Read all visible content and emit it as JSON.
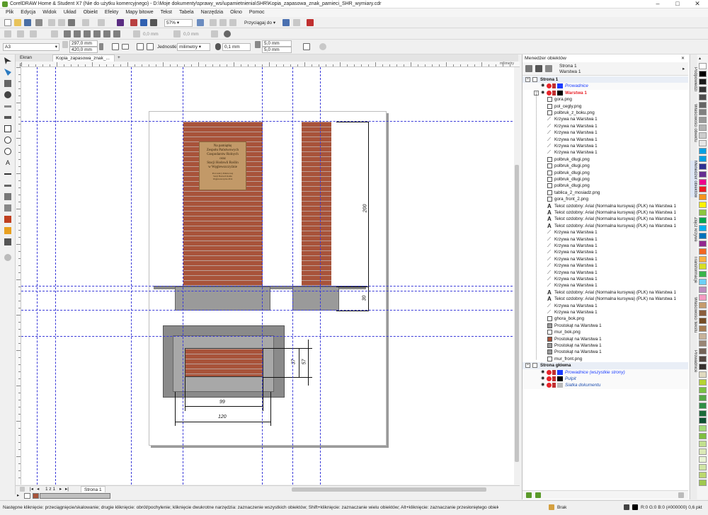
{
  "window": {
    "title": "CorelDRAW Home & Student X7 (Nie do użytku komercyjnego) - D:\\Moje dokumenty\\sprawy_wsi\\upamietnienia\\SHR\\Kopia_zapasowa_znak_pamieci_SHR_wymiary.cdr"
  },
  "menu": [
    "Plik",
    "Edycja",
    "Widok",
    "Układ",
    "Obiekt",
    "Efekty",
    "Mapy bitowe",
    "Tekst",
    "Tabela",
    "Narzędzia",
    "Okno",
    "Pomoc"
  ],
  "standard_toolbar": {
    "zoom": "57%",
    "snap": "Przyciągaj do"
  },
  "property_bar": {
    "paper": "A3",
    "width": "297,0 mm",
    "height": "420,0 mm",
    "units_label": "Jednostki:",
    "units": "milimetry",
    "nudge": "0,1 mm",
    "dup_x": "5,0 mm",
    "dup_y": "5,0 mm",
    "disabled_x": "0,0 mm",
    "disabled_y": "0,0 mm"
  },
  "tabs": [
    "Ekran powitalny",
    "Kopia_zapasowa_znak_..."
  ],
  "ruler": {
    "unit": "milimetry"
  },
  "drawing": {
    "plaque_lines": [
      "Na pamiątkę",
      "Zespołu Państwowych",
      "Gospodarstw Rolnych",
      "oraz",
      "Stacji Hodowli Roślin",
      "w Węglewszczyźnie"
    ],
    "plaque_small": [
      "Pracownicy Państwowej",
      "Stacji Hodowli Roślin",
      "Węglewszczyzna 2014"
    ],
    "dimensions": {
      "height_main": "200",
      "height_base": "30",
      "inner_height": "37",
      "outer_height": "57",
      "inner_width": "99",
      "outer_width": "120"
    }
  },
  "page_nav": {
    "counter": "1 z 1",
    "page_tab": "Strona 1"
  },
  "status": {
    "hint": "Następne kliknięcie: przeciągnięcie/skalowanie; drugie kliknięcie: obrót/pochylenie; kliknięcie dwukrotne narzędzia: zaznaczenie wszystkich obiektów; Shift+kliknięcie: zaznaczanie wielu obiektów; Alt+kliknięcie: zaznaczanie przesłoniętego obiektu;",
    "fill": "Brak",
    "outline": "R:0 G:0 B:0 (#000000)  0,6 pkt"
  },
  "object_manager": {
    "title": "Menedżer obiektów",
    "header_page": "Strona 1",
    "header_layer": "Warstwa 1",
    "page1": "Strona 1",
    "guides": "Prowadnice",
    "layer1": "Warstwa 1",
    "items": [
      {
        "icon": "bitmap",
        "label": "gora.png"
      },
      {
        "icon": "bitmap",
        "label": "pol_cegly.png"
      },
      {
        "icon": "bitmap",
        "label": "polbruk_z_boku.png"
      },
      {
        "icon": "curve",
        "label": "Krzywa na Warstwa 1"
      },
      {
        "icon": "curve",
        "label": "Krzywa na Warstwa 1"
      },
      {
        "icon": "curve",
        "label": "Krzywa na Warstwa 1"
      },
      {
        "icon": "curve",
        "label": "Krzywa na Warstwa 1"
      },
      {
        "icon": "curve",
        "label": "Krzywa na Warstwa 1"
      },
      {
        "icon": "curve",
        "label": "Krzywa na Warstwa 1"
      },
      {
        "icon": "bitmap",
        "label": "polbruk_dlugi.png"
      },
      {
        "icon": "bitmap",
        "label": "polbruk_dlugi.png"
      },
      {
        "icon": "bitmap",
        "label": "polbruk_dlugi.png"
      },
      {
        "icon": "bitmap",
        "label": "polbruk_dlugi.png"
      },
      {
        "icon": "bitmap",
        "label": "polbruk_dlugi.png"
      },
      {
        "icon": "bitmap",
        "label": "tablica_2_mosiadz.png"
      },
      {
        "icon": "bitmap",
        "label": "gora_front_2.png"
      },
      {
        "icon": "text",
        "label": "Tekst ozdobny: Arial (Normalna kursywa) (PLK) na Warstwa 1"
      },
      {
        "icon": "text",
        "label": "Tekst ozdobny: Arial (Normalna kursywa) (PLK) na Warstwa 1"
      },
      {
        "icon": "text",
        "label": "Tekst ozdobny: Arial (Normalna kursywa) (PLK) na Warstwa 1"
      },
      {
        "icon": "text",
        "label": "Tekst ozdobny: Arial (Normalna kursywa) (PLK) na Warstwa 1"
      },
      {
        "icon": "curve",
        "label": "Krzywa na Warstwa 1"
      },
      {
        "icon": "curve",
        "label": "Krzywa na Warstwa 1"
      },
      {
        "icon": "curve",
        "label": "Krzywa na Warstwa 1"
      },
      {
        "icon": "curve",
        "label": "Krzywa na Warstwa 1"
      },
      {
        "icon": "curve",
        "label": "Krzywa na Warstwa 1"
      },
      {
        "icon": "curve",
        "label": "Krzywa na Warstwa 1"
      },
      {
        "icon": "curve",
        "label": "Krzywa na Warstwa 1"
      },
      {
        "icon": "curve",
        "label": "Krzywa na Warstwa 1"
      },
      {
        "icon": "curve",
        "label": "Krzywa na Warstwa 1"
      },
      {
        "icon": "text",
        "label": "Tekst ozdobny: Arial (Normalna kursywa) (PLK) na Warstwa 1"
      },
      {
        "icon": "text",
        "label": "Tekst ozdobny: Arial (Normalna kursywa) (PLK) na Warstwa 1"
      },
      {
        "icon": "curve",
        "label": "Krzywa na Warstwa 1"
      },
      {
        "icon": "curve",
        "label": "Krzywa na Warstwa 1"
      },
      {
        "icon": "bitmap",
        "label": "ghora_bok.png"
      },
      {
        "icon": "rect-gray",
        "label": "Prostokąt na Warstwa 1"
      },
      {
        "icon": "bitmap",
        "label": "mur_bok.png"
      },
      {
        "icon": "rect-brick",
        "label": "Prostokąt na Warstwa 1"
      },
      {
        "icon": "rect-gray",
        "label": "Prostokąt na Warstwa 1"
      },
      {
        "icon": "rect-gray",
        "label": "Prostokąt na Warstwa 1"
      },
      {
        "icon": "bitmap",
        "label": "mur_front.png"
      }
    ],
    "master_page": "Strona główna",
    "master_items": [
      {
        "label": "Prowadnice (wszystkie strony)",
        "color": "#1a3cff"
      },
      {
        "label": "Pulpit",
        "color": "#000000"
      },
      {
        "label": "Siatka dokumentu",
        "color": "#bbbbbb"
      }
    ]
  },
  "docker_tabs": [
    "Podpowiedzi",
    "Właściwości obiektu",
    "Menedżer obiektów",
    "Złącz krzywe",
    "Transformacje",
    "Właściwości tekstu",
    "Prowadnice"
  ],
  "colors": {
    "brick": "#a8533a",
    "plaque": "#c29968",
    "base": "#9a9a9a",
    "guide": "#3a3ad8",
    "selected": "#e8242a",
    "palette": [
      "#ffffff",
      "#000000",
      "#1a1a1a",
      "#333333",
      "#4d4d4d",
      "#666666",
      "#808080",
      "#999999",
      "#b3b3b3",
      "#cccccc",
      "#e6e6e6",
      "#00a0e3",
      "#009fe3",
      "#2e3192",
      "#662d91",
      "#ec008c",
      "#ed1c24",
      "#f7941d",
      "#fff200",
      "#8dc63f",
      "#00a651",
      "#00aeef",
      "#0072bc",
      "#92278f",
      "#f26522",
      "#fbb040",
      "#d7df23",
      "#39b54a",
      "#6dcff6",
      "#bd8cbf",
      "#f49ac1",
      "#c69c6d",
      "#8b5e3c",
      "#754c24",
      "#a67c52",
      "#c7b299",
      "#998675",
      "#736357",
      "#534741",
      "#362f2d",
      "#e0d9c0",
      "#b5d334",
      "#7ac143",
      "#56a845",
      "#2f8f46",
      "#1c6b3a",
      "#0f5132",
      "#a3d977",
      "#7fbf3f",
      "#c2e08f",
      "#dbe9b7",
      "#e8f3d4",
      "#d0e6a5",
      "#bcd86e",
      "#9fc84f"
    ]
  }
}
